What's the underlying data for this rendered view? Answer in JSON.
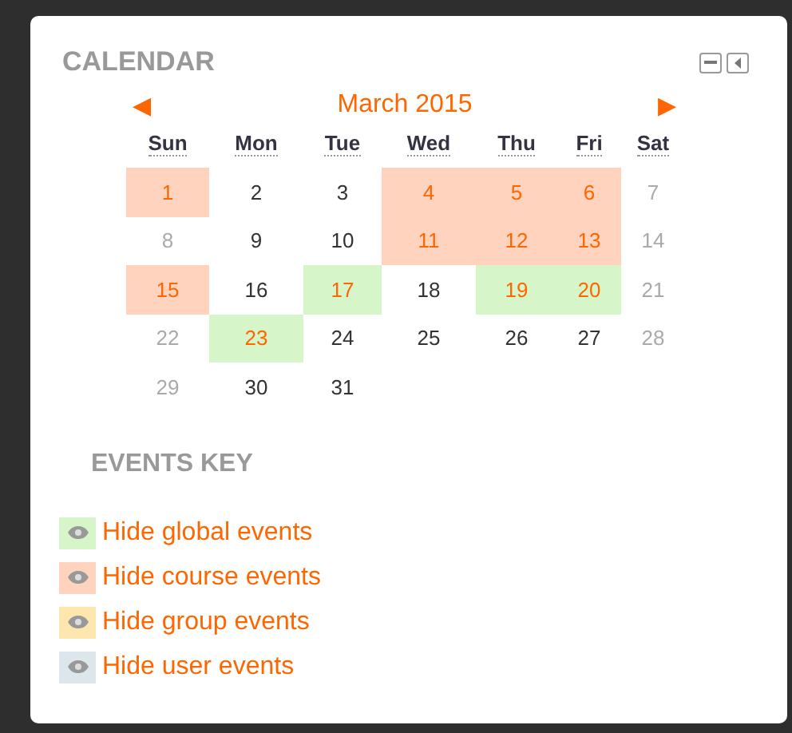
{
  "block": {
    "title": "CALENDAR"
  },
  "month": {
    "prev": "◀",
    "label": "March 2015",
    "next": "▶"
  },
  "weekdays": [
    "Sun",
    "Mon",
    "Tue",
    "Wed",
    "Thu",
    "Fri",
    "Sat"
  ],
  "weeks": [
    [
      {
        "day": "1",
        "kind": "event",
        "color": "#ffd3bd"
      },
      {
        "day": "2",
        "kind": "weekday"
      },
      {
        "day": "3",
        "kind": "weekday"
      },
      {
        "day": "4",
        "kind": "event",
        "color": "#ffd3bd"
      },
      {
        "day": "5",
        "kind": "event",
        "color": "#ffd3bd"
      },
      {
        "day": "6",
        "kind": "event",
        "color": "#ffd3bd"
      },
      {
        "day": "7",
        "kind": "weekend"
      }
    ],
    [
      {
        "day": "8",
        "kind": "weekend"
      },
      {
        "day": "9",
        "kind": "weekday"
      },
      {
        "day": "10",
        "kind": "weekday"
      },
      {
        "day": "11",
        "kind": "event",
        "color": "#ffd3bd"
      },
      {
        "day": "12",
        "kind": "event",
        "color": "#ffd3bd"
      },
      {
        "day": "13",
        "kind": "event",
        "color": "#ffd3bd"
      },
      {
        "day": "14",
        "kind": "weekend"
      }
    ],
    [
      {
        "day": "15",
        "kind": "event",
        "color": "#ffd3bd"
      },
      {
        "day": "16",
        "kind": "weekday"
      },
      {
        "day": "17",
        "kind": "event",
        "color": "#d6f5c9"
      },
      {
        "day": "18",
        "kind": "weekday"
      },
      {
        "day": "19",
        "kind": "event",
        "color": "#d6f5c9"
      },
      {
        "day": "20",
        "kind": "event",
        "color": "#d6f5c9"
      },
      {
        "day": "21",
        "kind": "weekend"
      }
    ],
    [
      {
        "day": "22",
        "kind": "weekend"
      },
      {
        "day": "23",
        "kind": "event",
        "color": "#d6f5c9"
      },
      {
        "day": "24",
        "kind": "weekday"
      },
      {
        "day": "25",
        "kind": "weekday"
      },
      {
        "day": "26",
        "kind": "weekday"
      },
      {
        "day": "27",
        "kind": "weekday"
      },
      {
        "day": "28",
        "kind": "weekend"
      }
    ],
    [
      {
        "day": "29",
        "kind": "weekend"
      },
      {
        "day": "30",
        "kind": "weekday"
      },
      {
        "day": "31",
        "kind": "weekday"
      }
    ]
  ],
  "events_key": {
    "title": "EVENTS KEY",
    "items": [
      {
        "label": "Hide global events",
        "color": "#d6f5c9"
      },
      {
        "label": "Hide course events",
        "color": "#ffd3bd"
      },
      {
        "label": "Hide group events",
        "color": "#fee7ae"
      },
      {
        "label": "Hide user events",
        "color": "#dce7ec"
      }
    ]
  }
}
